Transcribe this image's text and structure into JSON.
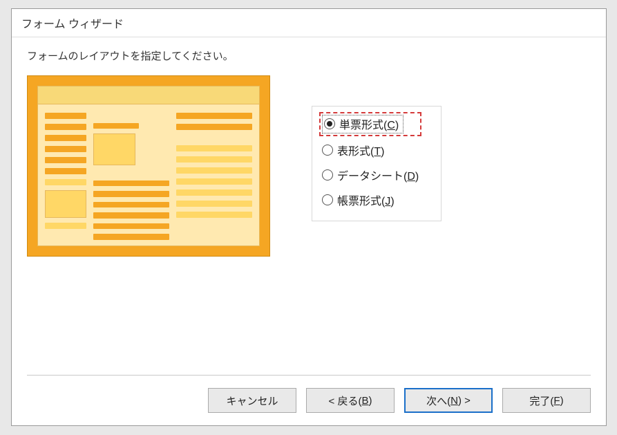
{
  "dialog": {
    "title": "フォーム ウィザード",
    "instruction": "フォームのレイアウトを指定してください。"
  },
  "options": {
    "items": [
      {
        "label": "単票形式",
        "mnemonic": "C",
        "selected": true
      },
      {
        "label": "表形式",
        "mnemonic": "T",
        "selected": false
      },
      {
        "label": "データシート",
        "mnemonic": "D",
        "selected": false
      },
      {
        "label": "帳票形式",
        "mnemonic": "J",
        "selected": false
      }
    ]
  },
  "buttons": {
    "cancel": "キャンセル",
    "back_prefix": "< 戻る(",
    "back_mnemonic": "B",
    "back_suffix": ")",
    "next_prefix": "次へ(",
    "next_mnemonic": "N",
    "next_suffix": ") >",
    "finish_prefix": "完了(",
    "finish_mnemonic": "F",
    "finish_suffix": ")"
  }
}
